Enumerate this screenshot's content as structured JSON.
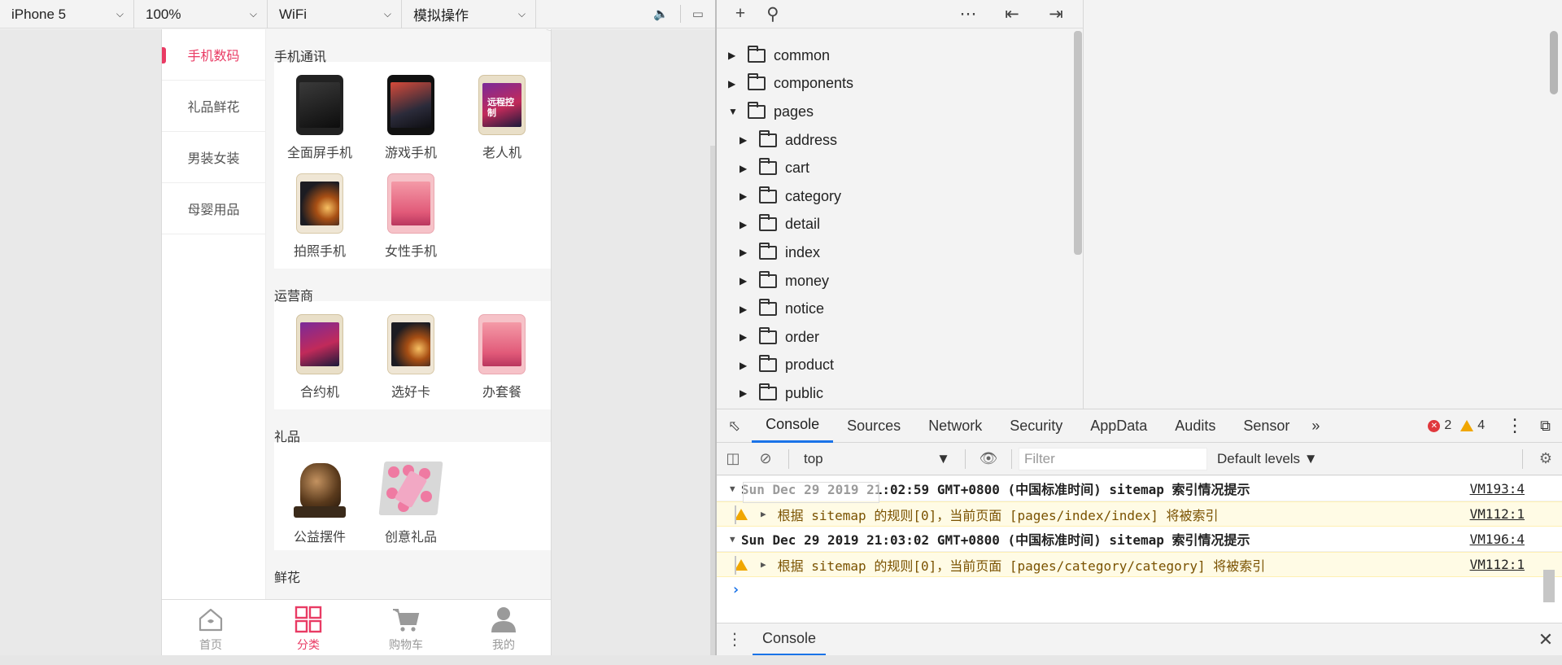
{
  "simulator": {
    "device": "iPhone 5",
    "zoom": "100%",
    "network": "WiFi",
    "action": "模拟操作"
  },
  "app": {
    "categories": [
      {
        "label": "手机数码",
        "active": true
      },
      {
        "label": "礼品鲜花",
        "active": false
      },
      {
        "label": "男装女装",
        "active": false
      },
      {
        "label": "母婴用品",
        "active": false
      }
    ],
    "sections": [
      {
        "title": "手机通讯",
        "items": [
          "全面屏手机",
          "游戏手机",
          "老人机",
          "拍照手机",
          "女性手机"
        ]
      },
      {
        "title": "运营商",
        "items": [
          "合约机",
          "选好卡",
          "办套餐"
        ]
      },
      {
        "title": "礼品",
        "items": [
          "公益摆件",
          "创意礼品"
        ]
      },
      {
        "title": "鲜花",
        "items": []
      }
    ],
    "tabbar": [
      {
        "label": "首页",
        "icon": "home-icon",
        "active": false
      },
      {
        "label": "分类",
        "icon": "grid-icon",
        "active": true
      },
      {
        "label": "购物车",
        "icon": "cart-icon",
        "active": false
      },
      {
        "label": "我的",
        "icon": "user-icon",
        "active": false
      }
    ],
    "accent": "#e93b64"
  },
  "filetree": {
    "items": [
      {
        "name": "common",
        "level": 0,
        "open": false
      },
      {
        "name": "components",
        "level": 0,
        "open": false
      },
      {
        "name": "pages",
        "level": 0,
        "open": true
      },
      {
        "name": "address",
        "level": 1,
        "open": false
      },
      {
        "name": "cart",
        "level": 1,
        "open": false
      },
      {
        "name": "category",
        "level": 1,
        "open": false
      },
      {
        "name": "detail",
        "level": 1,
        "open": false
      },
      {
        "name": "index",
        "level": 1,
        "open": false
      },
      {
        "name": "money",
        "level": 1,
        "open": false
      },
      {
        "name": "notice",
        "level": 1,
        "open": false
      },
      {
        "name": "order",
        "level": 1,
        "open": false
      },
      {
        "name": "product",
        "level": 1,
        "open": false
      },
      {
        "name": "public",
        "level": 1,
        "open": false
      }
    ]
  },
  "devtools": {
    "tabs": [
      "Console",
      "Sources",
      "Network",
      "Security",
      "AppData",
      "Audits",
      "Sensor"
    ],
    "active_tab": "Console",
    "errors": "2",
    "warnings": "4",
    "context": "top",
    "filter_placeholder": "Filter",
    "levels": "Default levels",
    "logs": [
      {
        "type": "group",
        "text": "Sun Dec 29 2019 21:02:59 GMT+0800 (中国标准时间) sitemap 索引情况提示",
        "source": "VM193:4"
      },
      {
        "type": "warn",
        "text": "根据 sitemap 的规则[0]，当前页面 [pages/index/index] 将被索引",
        "source": "VM112:1"
      },
      {
        "type": "group",
        "text": "Sun Dec 29 2019 21:03:02 GMT+0800 (中国标准时间) sitemap 索引情况提示",
        "source": "VM196:4"
      },
      {
        "type": "warn",
        "text": "根据 sitemap 的规则[0]，当前页面 [pages/category/category] 将被索引",
        "source": "VM112:1"
      }
    ],
    "drawer_tab": "Console"
  }
}
